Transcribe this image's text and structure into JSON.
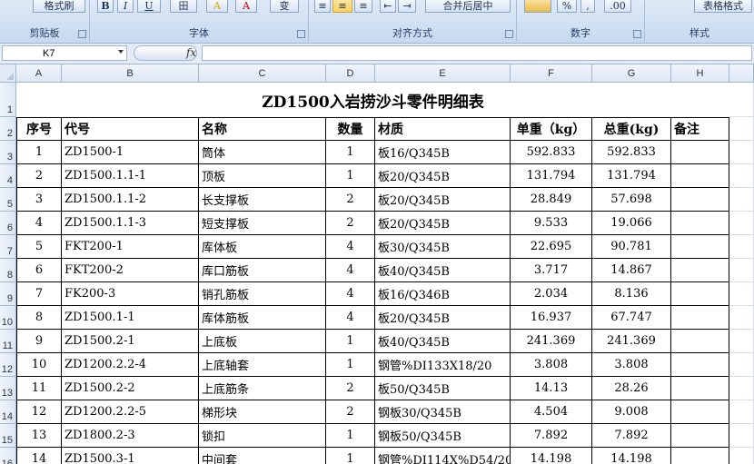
{
  "ribbon": {
    "groups": [
      {
        "label": "剪贴板",
        "button": "格式刷"
      },
      {
        "label": "字体",
        "buttons": [
          "B",
          "I",
          "U",
          "田",
          "A",
          "A",
          "变"
        ]
      },
      {
        "label": "对齐方式",
        "buttons": [
          "≡",
          "≡",
          "≡",
          "⇤",
          "⇥",
          "合并后居中"
        ]
      },
      {
        "label": "数字",
        "buttons": [
          "%",
          ",",
          ".00"
        ]
      },
      {
        "label": "样式",
        "button": "表格格式"
      }
    ]
  },
  "formula_bar": {
    "name_box": "K7",
    "fx": "fx",
    "formula": ""
  },
  "columns": [
    "A",
    "B",
    "C",
    "D",
    "E",
    "F",
    "G",
    "H"
  ],
  "rows": [
    "1",
    "2",
    "3",
    "4",
    "5",
    "6",
    "7",
    "8",
    "9",
    "10",
    "11",
    "12",
    "13",
    "14",
    "15",
    "16"
  ],
  "sheet": {
    "title": "ZD1500入岩捞沙斗零件明细表",
    "headers": [
      "序号",
      "代号",
      "名称",
      "数量",
      "材质",
      "单重（kg）",
      "总重(kg)",
      "备注"
    ],
    "data": [
      [
        "1",
        "ZD1500-1",
        "筒体",
        "1",
        "板16/Q345B",
        "592.833",
        "592.833",
        ""
      ],
      [
        "2",
        "ZD1500.1.1-1",
        "顶板",
        "1",
        "板20/Q345B",
        "131.794",
        "131.794",
        ""
      ],
      [
        "3",
        "ZD1500.1.1-2",
        "长支撑板",
        "2",
        "板20/Q345B",
        "28.849",
        "57.698",
        ""
      ],
      [
        "4",
        "ZD1500.1.1-3",
        "短支撑板",
        "2",
        "板20/Q345B",
        "9.533",
        "19.066",
        ""
      ],
      [
        "5",
        "FKT200-1",
        "库体板",
        "4",
        "板30/Q345B",
        "22.695",
        "90.781",
        ""
      ],
      [
        "6",
        "FKT200-2",
        "库口筋板",
        "4",
        "板40/Q345B",
        "3.717",
        "14.867",
        ""
      ],
      [
        "7",
        "FK200-3",
        "销孔筋板",
        "4",
        "板16/Q346B",
        "2.034",
        "8.136",
        ""
      ],
      [
        "8",
        "ZD1500.1-1",
        "库体筋板",
        "4",
        "板20/Q345B",
        "16.937",
        "67.747",
        ""
      ],
      [
        "9",
        "ZD1500.2-1",
        "上底板",
        "1",
        "板40/Q345B",
        "241.369",
        "241.369",
        ""
      ],
      [
        "10",
        "ZD1200.2.2-4",
        "上底轴套",
        "1",
        "钢管%DI133X18/20",
        "3.808",
        "3.808",
        ""
      ],
      [
        "11",
        "ZD1500.2-2",
        "上底筋条",
        "2",
        "板50/Q345B",
        "14.13",
        "28.26",
        ""
      ],
      [
        "12",
        "ZD1200.2.2-5",
        "梯形块",
        "2",
        "钢板30/Q345B",
        "4.504",
        "9.008",
        ""
      ],
      [
        "13",
        "ZD1800.2-3",
        "锁扣",
        "1",
        "钢板50/Q345B",
        "7.892",
        "7.892",
        ""
      ],
      [
        "14",
        "ZD1500.3-1",
        "中间套",
        "1",
        "钢管%DI114X%D54/20",
        "14.198",
        "14.198",
        ""
      ]
    ]
  }
}
